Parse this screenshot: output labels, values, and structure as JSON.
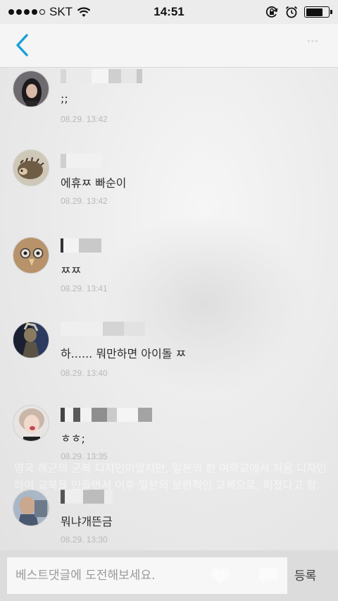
{
  "status_bar": {
    "carrier": "SKT",
    "time": "14:51",
    "battery_level": 0.75
  },
  "nav": {
    "faint_label": "ᐩᐩᐩ"
  },
  "comments": [
    {
      "text": ";;",
      "time": "08.29. 13:42",
      "avatar": "avatar-woman-icon"
    },
    {
      "text": "에휴ㅉ 빠순이",
      "time": "08.29. 13:42",
      "avatar": "avatar-hedgehog-icon"
    },
    {
      "text": "ㅉㅉ",
      "time": "08.29. 13:41",
      "avatar": "avatar-owl-icon"
    },
    {
      "text": "하...... 뭐만하면 아이돌 ㅉ",
      "time": "08.29. 13:40",
      "avatar": "avatar-costume-icon"
    },
    {
      "text": "ㅎㅎ;",
      "time": "08.29. 13:35",
      "avatar": "avatar-girl-icon"
    },
    {
      "text": "뭐냐개뜬금",
      "time": "08.29. 13:30",
      "avatar": "avatar-man-icon"
    }
  ],
  "ghost_text": "영국 해군의 군복 디자인이었지만, 일본의 한 여학교에서 처음 디자인하여 교복을 만들면서 이후 일본의 보편적인 교복으로, 퍼졌다고 함.",
  "input": {
    "placeholder": "베스트댓글에 도전해보세요.",
    "value": "",
    "submit_label": "등록"
  },
  "colors": {
    "accent": "#1a9fd6",
    "background": "#ececec"
  }
}
